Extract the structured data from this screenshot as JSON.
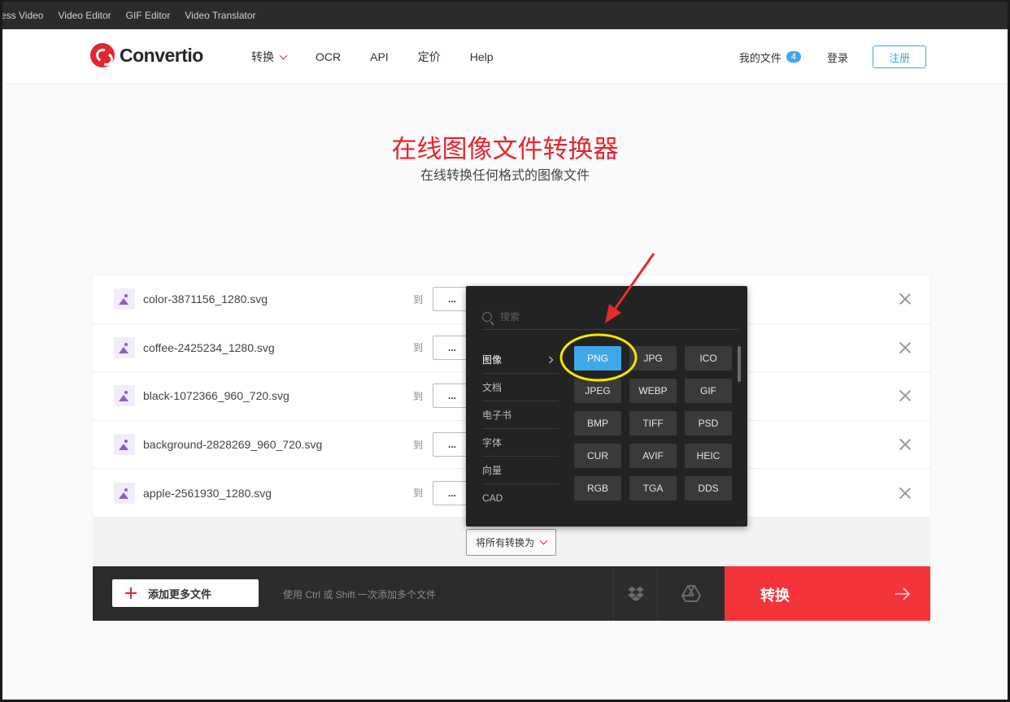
{
  "topbar": {
    "items": [
      "ess Video",
      "Video Editor",
      "GIF Editor",
      "Video Translator"
    ]
  },
  "header": {
    "logo_text": "Convertio",
    "nav": [
      "转换",
      "OCR",
      "API",
      "定价",
      "Help"
    ],
    "my_files": "我的文件",
    "my_files_count": "4",
    "login": "登录",
    "signup": "注册"
  },
  "hero": {
    "title": "在线图像文件转换器",
    "subtitle": "在线转换任何格式的图像文件"
  },
  "files": [
    {
      "name": "color-3871156_1280.svg",
      "to": "到",
      "select": "..."
    },
    {
      "name": "coffee-2425234_1280.svg",
      "to": "到",
      "select": "..."
    },
    {
      "name": "black-1072366_960_720.svg",
      "to": "到",
      "select": "..."
    },
    {
      "name": "background-2828269_960_720.svg",
      "to": "到",
      "select": "..."
    },
    {
      "name": "apple-2561930_1280.svg",
      "to": "到",
      "select": "..."
    }
  ],
  "convert_all": "将所有转换为",
  "bottom": {
    "add_more": "添加更多文件",
    "hint": "使用 Ctrl 或 Shift 一次添加多个文件",
    "convert": "转换"
  },
  "dropdown": {
    "search_placeholder": "搜索",
    "categories": [
      "图像",
      "文档",
      "电子书",
      "字体",
      "向量",
      "CAD"
    ],
    "active_category": "图像",
    "formats": [
      "PNG",
      "JPG",
      "ICO",
      "JPEG",
      "WEBP",
      "GIF",
      "BMP",
      "TIFF",
      "PSD",
      "CUR",
      "AVIF",
      "HEIC",
      "RGB",
      "TGA",
      "DDS"
    ],
    "selected_format": "PNG"
  },
  "colors": {
    "brand_red": "#e3262f",
    "accent_blue": "#3fa8e8",
    "highlight_yellow": "#f2e600"
  }
}
